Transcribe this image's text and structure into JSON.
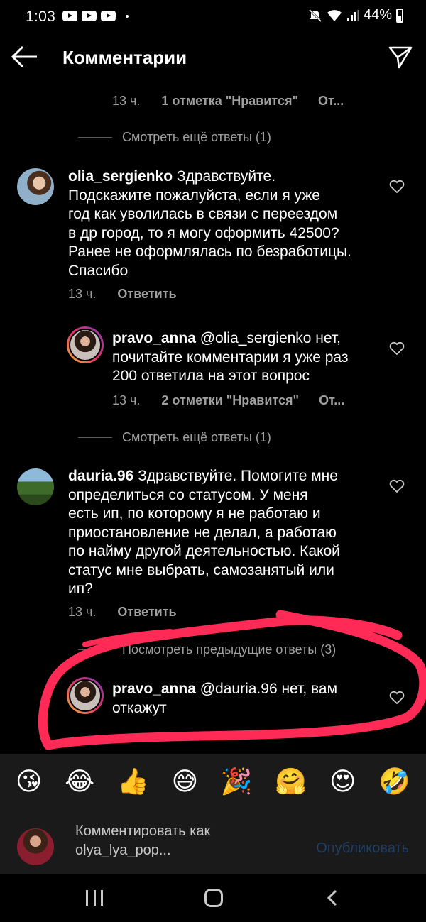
{
  "status_bar": {
    "time": "1:03",
    "battery": "44%",
    "icons": [
      "youtube-icon",
      "youtube-icon",
      "youtube-icon",
      "mute-icon",
      "wifi-icon",
      "signal-icon",
      "battery-icon"
    ]
  },
  "header": {
    "title": "Комментарии",
    "back_icon": "arrow-left-icon",
    "send_icon": "paper-plane-icon"
  },
  "thread": {
    "top_meta": {
      "time": "13 ч.",
      "likes": "1 отметка \"Нравится\"",
      "reply": "От..."
    },
    "view_more_1": "Смотреть ещё ответы (1)",
    "comment_1": {
      "username": "olia_sergienko",
      "text": "Здравствуйте. Подскажите пожалуйста,  если я уже год как уволилась в связи с переездом в др город,  то я могу оформить 42500? Ранее не оформлялась по безработицы. Спасибо",
      "lines": [
        "Здравствуйте.",
        "Подскажите пожалуйста,  если я уже",
        "год как уволилась в связи с переездом",
        "в др город,  то я могу оформить 42500?",
        "Ранее не оформлялась по безработицы.",
        "Спасибо"
      ],
      "time": "13 ч.",
      "reply": "Ответить"
    },
    "reply_1": {
      "username": "pravo_anna",
      "lines": [
        "@olia_sergienko нет,",
        "почитайте комментарии я уже раз",
        "200 ответила на этот вопрос"
      ],
      "time": "13 ч.",
      "likes": "2 отметки \"Нравится\"",
      "reply": "От..."
    },
    "view_more_2": "Смотреть ещё ответы (1)",
    "comment_2": {
      "username": "dauria.96",
      "lines": [
        "Здравствуйте. Помогите мне",
        "определиться со статусом. У меня",
        "есть ип, по которому я не работаю и",
        "приостановление не делал, а работаю",
        "по найму другой деятельностью. Какой",
        "статус мне выбрать, самозанятый или",
        "ип?"
      ],
      "time": "13 ч.",
      "reply": "Ответить"
    },
    "view_previous": "Посмотреть предыдущие ответы (3)",
    "reply_2": {
      "username": "pravo_anna",
      "lines": [
        "@dauria.96 нет, вам",
        "откажут"
      ]
    }
  },
  "emoji_bar": [
    "😘",
    "😂",
    "👍",
    "😅",
    "🎉",
    "🤗",
    "😍",
    "🤣"
  ],
  "composer": {
    "placeholder_line1": "Комментировать как",
    "placeholder_line2": "olya_lya_pop...",
    "publish": "Опубликовать"
  },
  "colors": {
    "background": "#000000",
    "secondary_text": "#a0a0a0",
    "publish_disabled": "#1e3f66",
    "annotation": "#ff2a55"
  }
}
